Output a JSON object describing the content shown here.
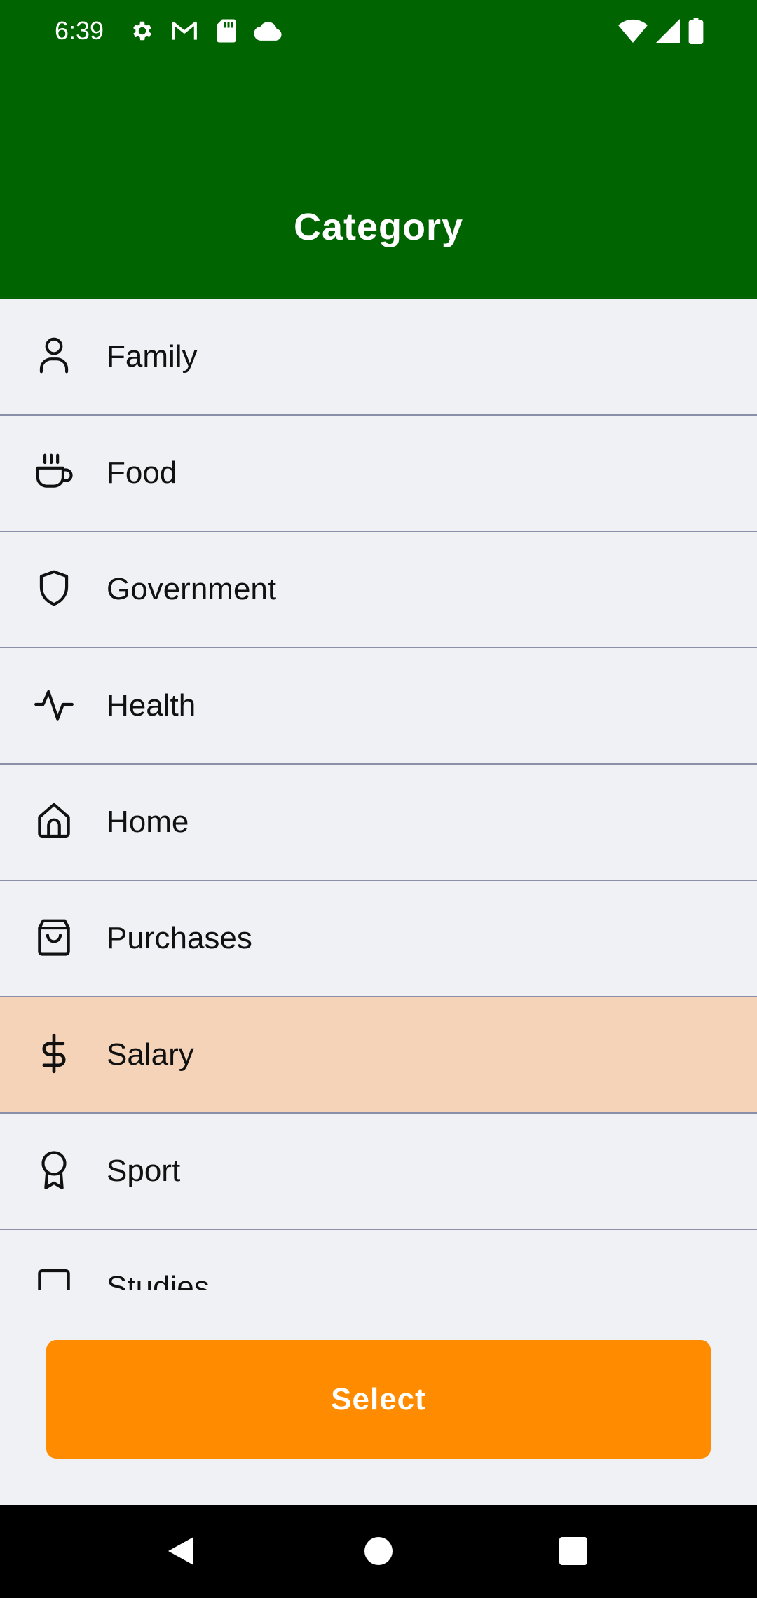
{
  "status_bar": {
    "time": "6:39",
    "left_icons": [
      "settings-icon",
      "gmail-icon",
      "sd-card-icon",
      "cloud-icon"
    ],
    "right_icons": [
      "wifi-icon",
      "cellular-signal-icon",
      "battery-icon"
    ]
  },
  "header": {
    "title": "Category",
    "background_color": "#006400"
  },
  "categories": [
    {
      "label": "Family",
      "icon": "person-icon",
      "selected": false
    },
    {
      "label": "Food",
      "icon": "coffee-cup-icon",
      "selected": false
    },
    {
      "label": "Government",
      "icon": "shield-icon",
      "selected": false
    },
    {
      "label": "Health",
      "icon": "activity-icon",
      "selected": false
    },
    {
      "label": "Home",
      "icon": "house-icon",
      "selected": false
    },
    {
      "label": "Purchases",
      "icon": "shopping-bag-icon",
      "selected": false
    },
    {
      "label": "Salary",
      "icon": "dollar-icon",
      "selected": true
    },
    {
      "label": "Sport",
      "icon": "award-icon",
      "selected": false
    },
    {
      "label": "Studies",
      "icon": "book-icon",
      "selected": false
    }
  ],
  "select_button": {
    "label": "Select",
    "color": "#ff8c00"
  },
  "colors": {
    "selected_row": "#f5d3b9",
    "list_background": "#eff1f5"
  },
  "nav_bar": {
    "buttons": [
      "back-icon",
      "home-icon",
      "recents-icon"
    ]
  }
}
